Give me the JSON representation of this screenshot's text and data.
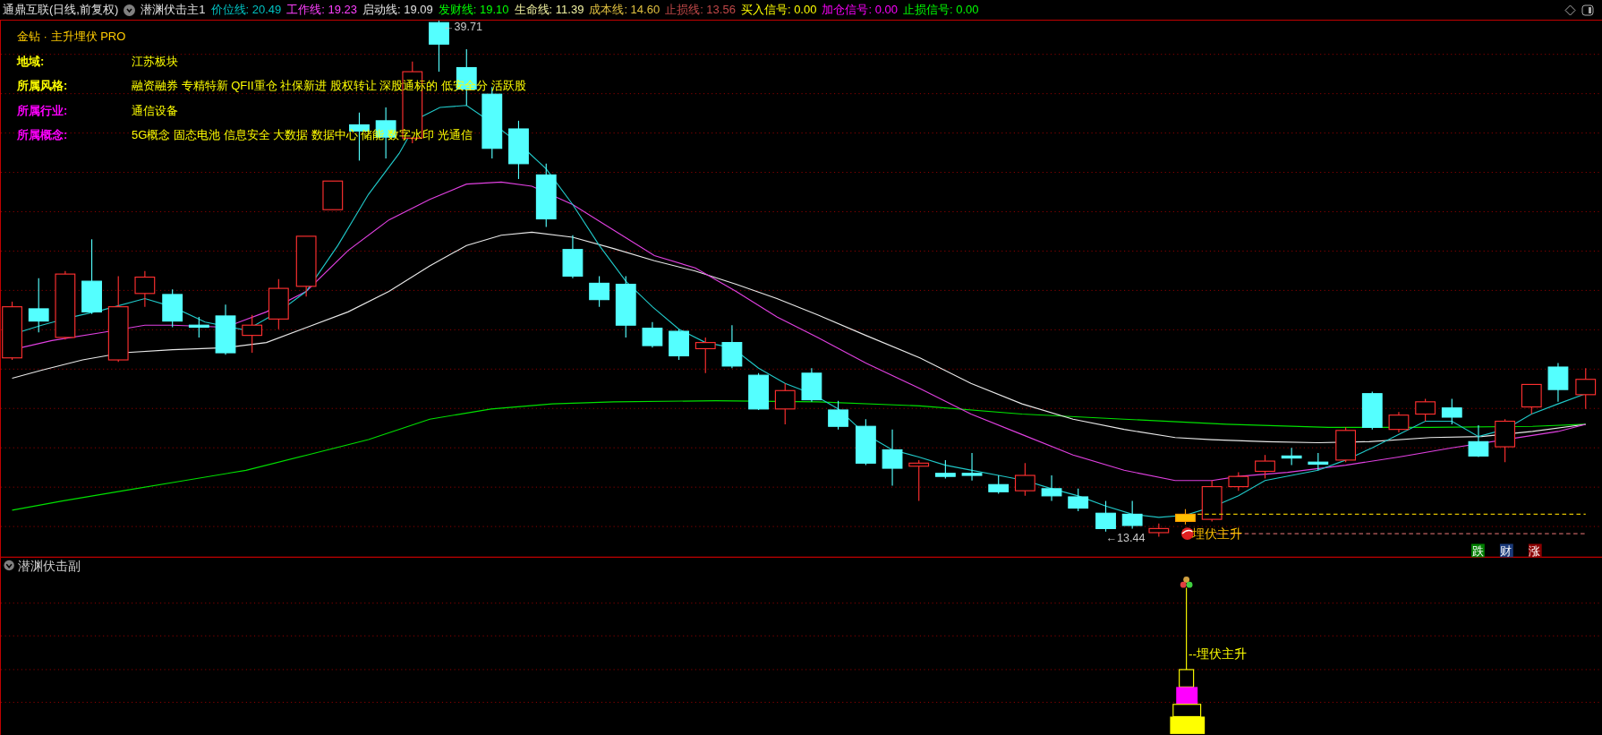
{
  "header": {
    "title": "通鼎互联(日线,前复权)",
    "indicator_name": "潜渊伏击主1",
    "readings": [
      {
        "text": "价位线: 20.49",
        "color": "#00c0c0"
      },
      {
        "text": "工作线: 19.23",
        "color": "#ff40ff"
      },
      {
        "text": "启动线: 19.09",
        "color": "#e0e0e0"
      },
      {
        "text": "发财线: 19.10",
        "color": "#00ff00"
      },
      {
        "text": "生命线: 11.39",
        "color": "#f0f0a0"
      },
      {
        "text": "成本线: 14.60",
        "color": "#e0c040"
      },
      {
        "text": "止损线: 13.56",
        "color": "#c04848"
      },
      {
        "text": "买入信号: 0.00",
        "color": "#ffff00"
      },
      {
        "text": "加仓信号: 0.00",
        "color": "#ff00ff"
      },
      {
        "text": "止损信号: 0.00",
        "color": "#00ff00"
      }
    ]
  },
  "info_panel": {
    "title": "金钻 · 主升埋伏 PRO",
    "rows": [
      {
        "label": "地域:",
        "value": "江苏板块",
        "color": "#ffff00"
      },
      {
        "label": "所属风格:",
        "value": "融资融券 专精特新 QFII重仓 社保新进 股权转让 深股通标的 低安全分 活跃股",
        "color": "#ffff00"
      },
      {
        "label": "所属行业:",
        "value": "通信设备",
        "color": "#ff00ff"
      },
      {
        "label": "所属概念:",
        "value": "5G概念 固态电池 信息安全 大数据 数据中心 储能 数字水印 光通信",
        "color": "#ff00ff"
      }
    ]
  },
  "main_chart": {
    "high_label": "←39.71",
    "low_label": "←13.44",
    "signal_label": "埋伏主升",
    "badges": [
      {
        "text": "跌",
        "color": "#008000"
      },
      {
        "text": "财",
        "color": "#1a3a7a"
      },
      {
        "text": "涨",
        "color": "#8b0000"
      }
    ]
  },
  "sub_panel": {
    "title": "潜渊伏击副",
    "signal_label": "--埋伏主升"
  }
}
